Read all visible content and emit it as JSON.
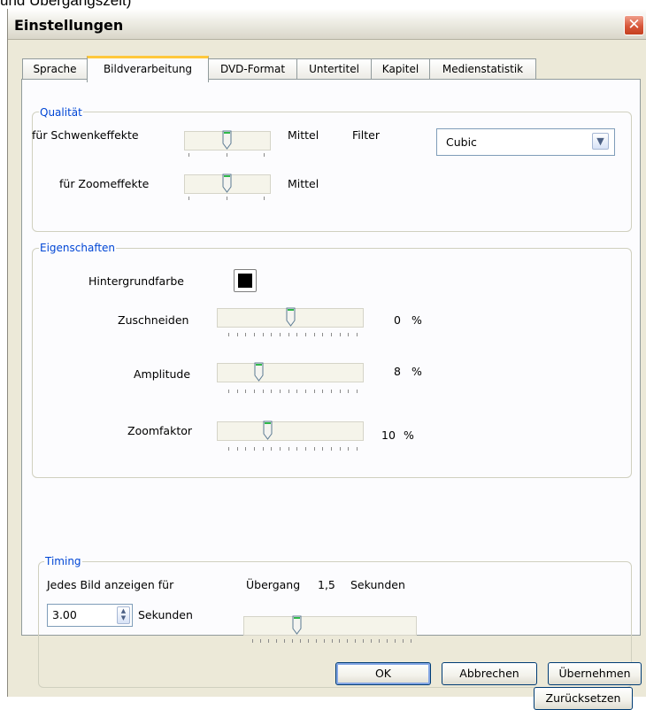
{
  "top_caption": "und Übergangszeit)",
  "window": {
    "title": "Einstellungen"
  },
  "tabs": [
    {
      "label": "Sprache",
      "active": false
    },
    {
      "label": "Bildverarbeitung",
      "active": true
    },
    {
      "label": "DVD-Format",
      "active": false
    },
    {
      "label": "Untertitel",
      "active": false
    },
    {
      "label": "Kapitel",
      "active": false
    },
    {
      "label": "Medienstatistik",
      "active": false
    }
  ],
  "quality": {
    "legend": "Qualität",
    "pan_label": "für Schwenkeffekte",
    "pan_value": "Mittel",
    "pan_level": 0.5,
    "zoom_label": "für Zoomeffekte",
    "zoom_value": "Mittel",
    "zoom_level": 0.5,
    "filter_label": "Filter",
    "filter_value": "Cubic"
  },
  "properties": {
    "legend": "Eigenschaften",
    "background_label": "Hintergrundfarbe",
    "background_color": "#000000",
    "crop_label": "Zuschneiden",
    "crop_value": "0",
    "amplitude_label": "Amplitude",
    "amplitude_value": "8",
    "zoom_label": "Zoomfaktor",
    "zoom_value": "10",
    "unit": "%"
  },
  "timing": {
    "legend": "Timing",
    "show_label": "Jedes Bild anzeigen für",
    "duration_value": "3.00",
    "seconds_label": "Sekunden",
    "transition_label": "Übergang",
    "transition_value": "1,5",
    "transition_unit": "Sekunden"
  },
  "buttons": {
    "reset": "Zurücksetzen",
    "ok": "OK",
    "cancel": "Abbrechen",
    "apply": "Übernehmen"
  },
  "colors": {
    "accent_legend": "#0046d5",
    "tab_highlight": "#ffc83c",
    "close_button": "#d8573a"
  }
}
